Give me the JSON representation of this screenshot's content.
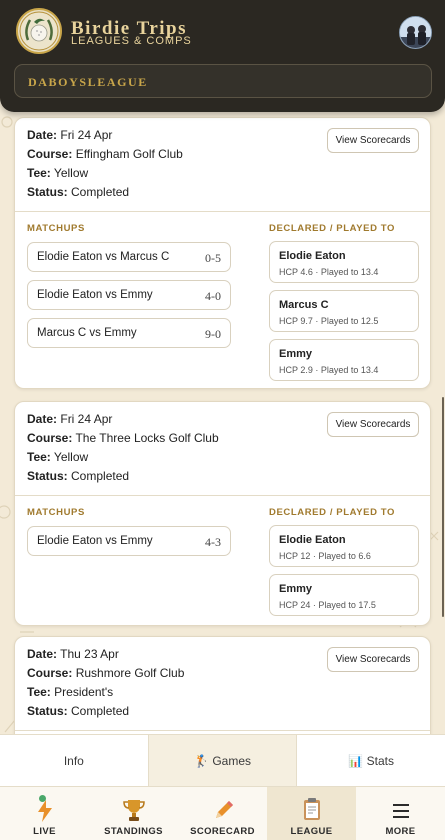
{
  "header": {
    "brand_title": "Birdie Trips",
    "brand_subtitle": "LEAGUES & COMPS",
    "league_name": "DABOYSLEAGUE"
  },
  "rounds": [
    {
      "date_label": "Date:",
      "date": "Fri 24 Apr",
      "course_label": "Course:",
      "course": "Effingham Golf Club",
      "tee_label": "Tee:",
      "tee": "Yellow",
      "status_label": "Status:",
      "status": "Completed",
      "view_label": "View Scorecards",
      "matchups_heading": "MATCHUPS",
      "declared_heading": "DECLARED / PLAYED TO",
      "matchups": [
        {
          "names": "Elodie Eaton vs Marcus C",
          "score": "0-5"
        },
        {
          "names": "Elodie Eaton vs Emmy",
          "score": "4-0"
        },
        {
          "names": "Marcus C vs Emmy",
          "score": "9-0"
        }
      ],
      "players": [
        {
          "name": "Elodie Eaton",
          "info": "HCP 4.6 · Played to 13.4"
        },
        {
          "name": "Marcus C",
          "info": "HCP 9.7 · Played to 12.5"
        },
        {
          "name": "Emmy",
          "info": "HCP 2.9 · Played to 13.4"
        }
      ]
    },
    {
      "date_label": "Date:",
      "date": "Fri 24 Apr",
      "course_label": "Course:",
      "course": "The Three Locks Golf Club",
      "tee_label": "Tee:",
      "tee": "Yellow",
      "status_label": "Status:",
      "status": "Completed",
      "view_label": "View Scorecards",
      "matchups_heading": "MATCHUPS",
      "declared_heading": "DECLARED / PLAYED TO",
      "matchups": [
        {
          "names": "Elodie Eaton vs Emmy",
          "score": "4-3"
        }
      ],
      "players": [
        {
          "name": "Elodie Eaton",
          "info": "HCP 12 · Played to 6.6"
        },
        {
          "name": "Emmy",
          "info": "HCP 24 · Played to 17.5"
        }
      ]
    },
    {
      "date_label": "Date:",
      "date": "Thu 23 Apr",
      "course_label": "Course:",
      "course": "Rushmore Golf Club",
      "tee_label": "Tee:",
      "tee": "President's",
      "status_label": "Status:",
      "status": "Completed",
      "view_label": "View Scorecards"
    }
  ],
  "subtabs": {
    "info": "Info",
    "games": "Games",
    "games_icon": "🏌️",
    "stats": "Stats",
    "stats_icon": "📊",
    "active": "games"
  },
  "bottom_nav": {
    "live": "LIVE",
    "standings": "STANDINGS",
    "scorecard": "SCORECARD",
    "league": "LEAGUE",
    "more": "MORE",
    "active": "league"
  },
  "colors": {
    "header_bg": "#2b2822",
    "gold": "#c9a64a",
    "accent_heading": "#a07a2e",
    "page_bg": "#f3ead7"
  }
}
